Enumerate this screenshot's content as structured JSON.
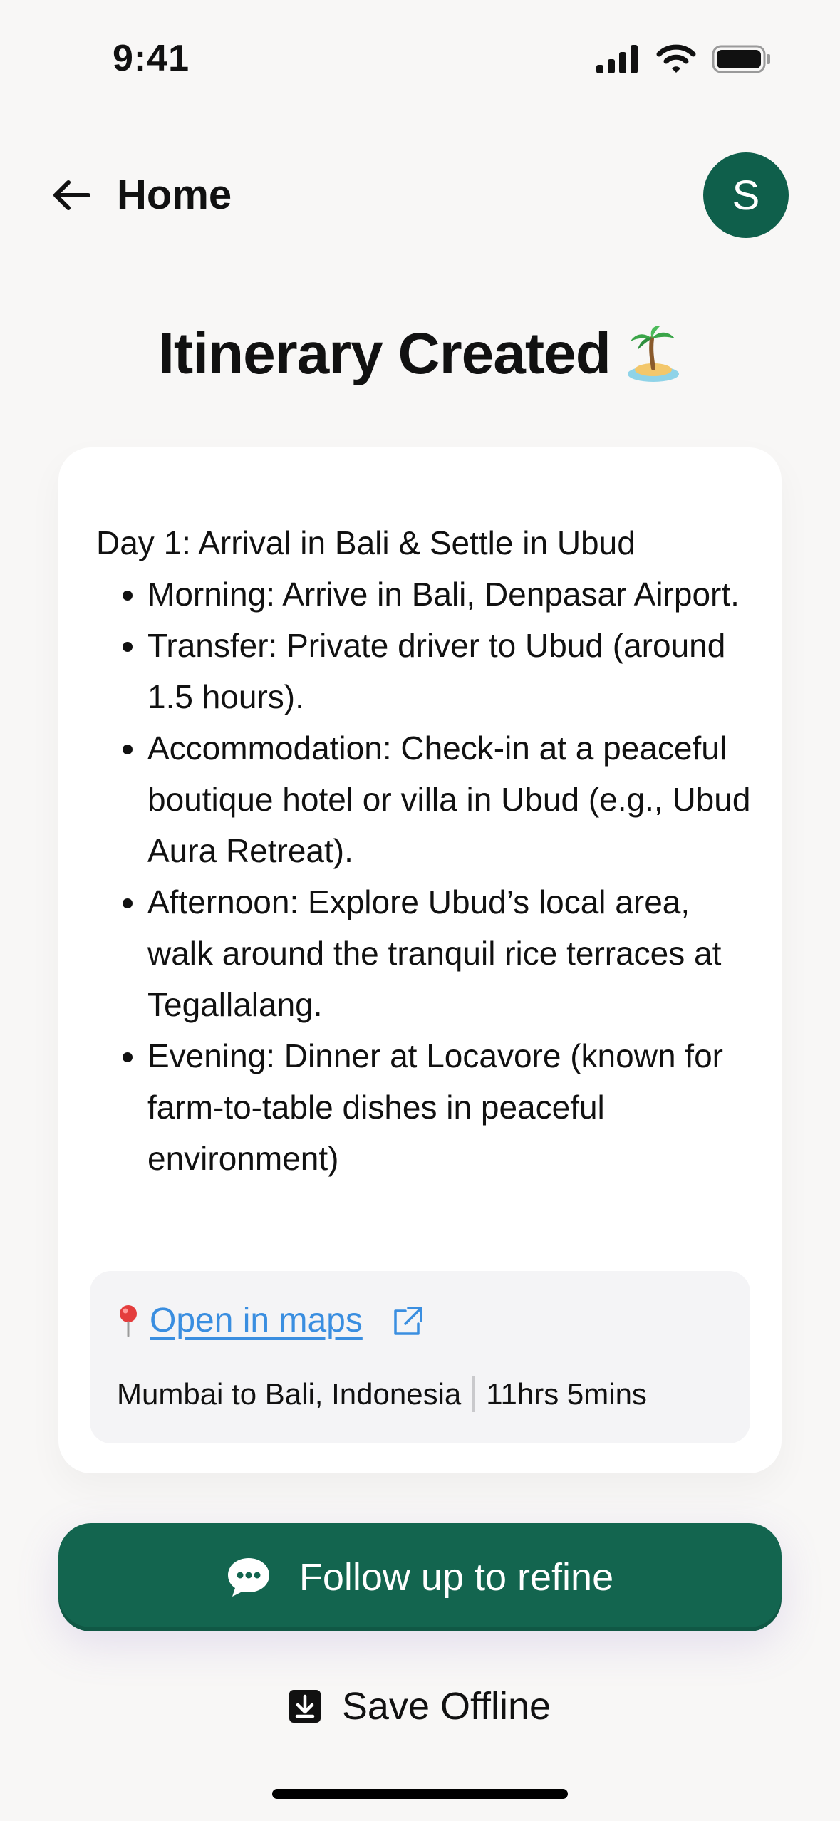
{
  "status_bar": {
    "time": "9:41"
  },
  "header": {
    "back_label": "Home",
    "avatar_initial": "S"
  },
  "page": {
    "title": "Itinerary Created",
    "title_icon": "palm-island-icon"
  },
  "itinerary": {
    "day_title": "Day 1: Arrival in Bali & Settle in Ubud",
    "items": [
      "Morning: Arrive in Bali, Denpasar Airport.",
      "Transfer: Private driver to Ubud (around 1.5 hours).",
      "Accommodation: Check-in at a peaceful boutique hotel or villa in Ubud (e.g., Ubud Aura Retreat).",
      "Afternoon: Explore Ubud’s local area, walk around the tranquil rice terraces at Tegallalang.",
      "Evening: Dinner at Locavore (known for farm-to-table dishes in peaceful environment)"
    ]
  },
  "maps": {
    "link_label": "Open in maps",
    "route": "Mumbai to Bali, Indonesia",
    "duration": "11hrs 5mins",
    "link_color": "#3a8ee0"
  },
  "actions": {
    "follow_up_label": "Follow up to refine",
    "save_offline_label": "Save Offline",
    "accent_color": "#13654f"
  }
}
